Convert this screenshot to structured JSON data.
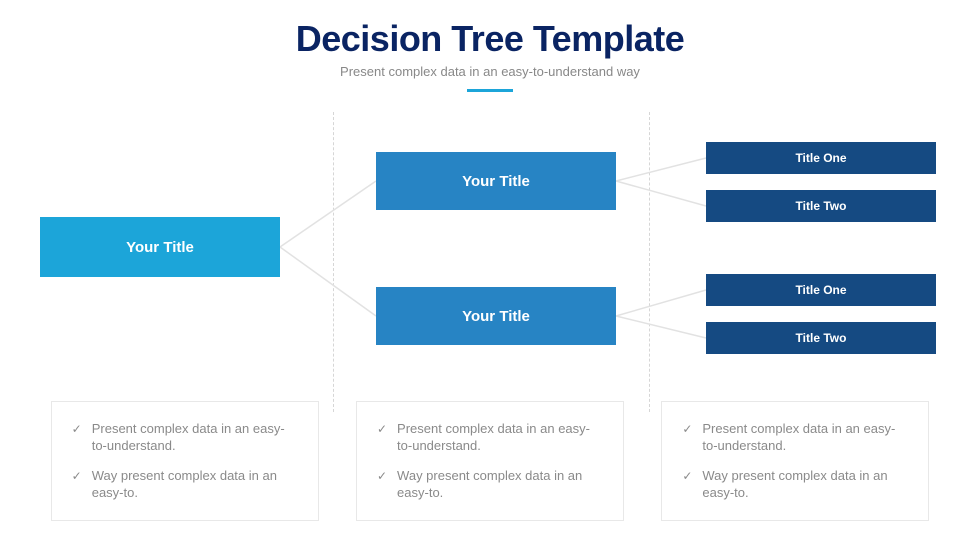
{
  "header": {
    "title": "Decision Tree Template",
    "subtitle": "Present complex data in an easy-to-understand way"
  },
  "tree": {
    "root": {
      "label": "Your Title"
    },
    "mid": [
      {
        "label": "Your Title"
      },
      {
        "label": "Your Title"
      }
    ],
    "leaves": [
      {
        "label": "Title One"
      },
      {
        "label": "Title Two"
      },
      {
        "label": "Title One"
      },
      {
        "label": "Title Two"
      }
    ]
  },
  "footer": {
    "columns": [
      {
        "items": [
          "Present complex data in an easy-to-understand.",
          "Way present complex data in an easy-to."
        ]
      },
      {
        "items": [
          "Present complex data in an easy-to-understand.",
          "Way present complex data in an easy-to."
        ]
      },
      {
        "items": [
          "Present complex data in an easy-to-understand.",
          "Way present complex data in an easy-to."
        ]
      }
    ]
  }
}
